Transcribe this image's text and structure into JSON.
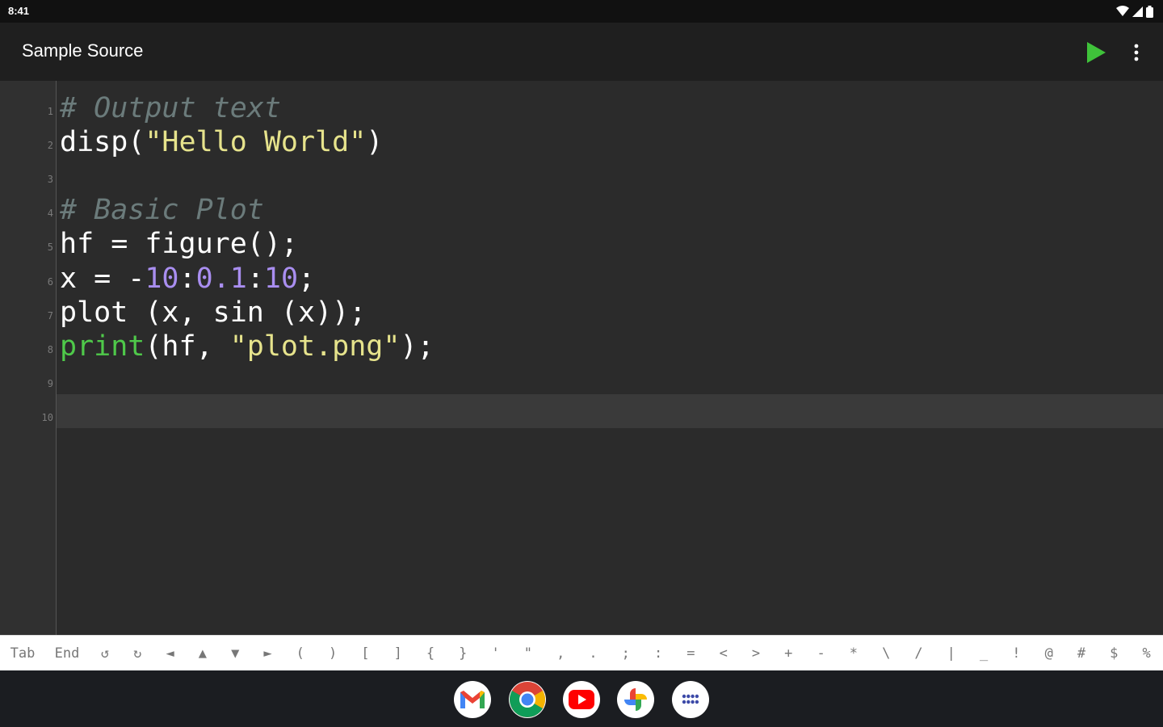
{
  "status_bar": {
    "time": "8:41"
  },
  "app_bar": {
    "title": "Sample Source",
    "run_icon": "play-icon",
    "more_icon": "more-vert-icon"
  },
  "editor": {
    "lines": [
      {
        "number": "1",
        "tokens": [
          {
            "text": "# Output text",
            "type": "comment"
          }
        ]
      },
      {
        "number": "2",
        "tokens": [
          {
            "text": "disp(",
            "type": "plain"
          },
          {
            "text": "\"Hello World\"",
            "type": "string"
          },
          {
            "text": ")",
            "type": "plain"
          }
        ]
      },
      {
        "number": "3",
        "tokens": []
      },
      {
        "number": "4",
        "tokens": [
          {
            "text": "# Basic Plot",
            "type": "comment"
          }
        ]
      },
      {
        "number": "5",
        "tokens": [
          {
            "text": "hf = figure();",
            "type": "plain"
          }
        ]
      },
      {
        "number": "6",
        "tokens": [
          {
            "text": "x = -",
            "type": "plain"
          },
          {
            "text": "10",
            "type": "number"
          },
          {
            "text": ":",
            "type": "plain"
          },
          {
            "text": "0.1",
            "type": "number"
          },
          {
            "text": ":",
            "type": "plain"
          },
          {
            "text": "10",
            "type": "number"
          },
          {
            "text": ";",
            "type": "plain"
          }
        ]
      },
      {
        "number": "7",
        "tokens": [
          {
            "text": "plot (x, sin (x));",
            "type": "plain"
          }
        ]
      },
      {
        "number": "8",
        "tokens": [
          {
            "text": "print",
            "type": "keyword"
          },
          {
            "text": "(hf, ",
            "type": "plain"
          },
          {
            "text": "\"plot.png\"",
            "type": "string"
          },
          {
            "text": ");",
            "type": "plain"
          }
        ]
      },
      {
        "number": "9",
        "tokens": []
      },
      {
        "number": "10",
        "tokens": []
      }
    ],
    "current_line": "10"
  },
  "symbol_bar": {
    "keys": [
      "Tab",
      "End",
      "↺",
      "↻",
      "◄",
      "▲",
      "▼",
      "►",
      "(",
      ")",
      "[",
      "]",
      "{",
      "}",
      "'",
      "\"",
      ",",
      ".",
      ";",
      ":",
      "=",
      "<",
      ">",
      "+",
      "-",
      "*",
      "\\",
      "/",
      "|",
      "_",
      "!",
      "@",
      "#",
      "$",
      "%"
    ]
  },
  "taskbar": {
    "apps": [
      {
        "name": "gmail",
        "icon": "gmail-icon"
      },
      {
        "name": "chrome",
        "icon": "chrome-icon"
      },
      {
        "name": "youtube",
        "icon": "youtube-icon"
      },
      {
        "name": "photos",
        "icon": "photos-icon"
      },
      {
        "name": "app-drawer",
        "icon": "app-grid-icon"
      }
    ]
  },
  "colors": {
    "comment": "#6b7b7b",
    "string": "#e6e38c",
    "number": "#a98ef0",
    "keyword": "#4fc94a",
    "run_button": "#3fc23a"
  }
}
